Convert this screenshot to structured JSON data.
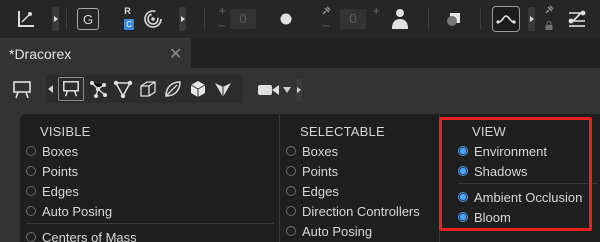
{
  "toolbar": {
    "icons": [
      "axes-icon",
      "g-icon",
      "spiral-icon",
      "point-icon",
      "person-icon",
      "shape-icon",
      "curve-icon",
      "pin-icon",
      "nodes-icon"
    ],
    "badge_r": "R",
    "badge_c": "C",
    "g_label": "G",
    "fields": [
      "0",
      "0"
    ],
    "plus": "+",
    "minus": "−"
  },
  "tab": {
    "title": "*Dracorex",
    "close": "✕"
  },
  "panel": {
    "columns": [
      {
        "header": "VISIBLE",
        "items": [
          {
            "label": "Boxes",
            "checked": false
          },
          {
            "label": "Points",
            "checked": false
          },
          {
            "label": "Edges",
            "checked": false
          },
          {
            "label": "Auto Posing",
            "checked": false
          },
          {
            "label": "Centers of Mass",
            "checked": false
          }
        ]
      },
      {
        "header": "SELECTABLE",
        "items": [
          {
            "label": "Boxes",
            "checked": false
          },
          {
            "label": "Points",
            "checked": false
          },
          {
            "label": "Edges",
            "checked": false
          },
          {
            "label": "Direction Controllers",
            "checked": false
          },
          {
            "label": "Auto Posing",
            "checked": false
          }
        ]
      },
      {
        "header": "VIEW",
        "items": [
          {
            "label": "Environment",
            "checked": true
          },
          {
            "label": "Shadows",
            "checked": true
          },
          {
            "label": "Ambient Occlusion",
            "checked": true
          },
          {
            "label": "Bloom",
            "checked": true
          }
        ]
      }
    ]
  },
  "colors": {
    "accent": "#4aa4ff",
    "highlight": "#e8221c"
  }
}
